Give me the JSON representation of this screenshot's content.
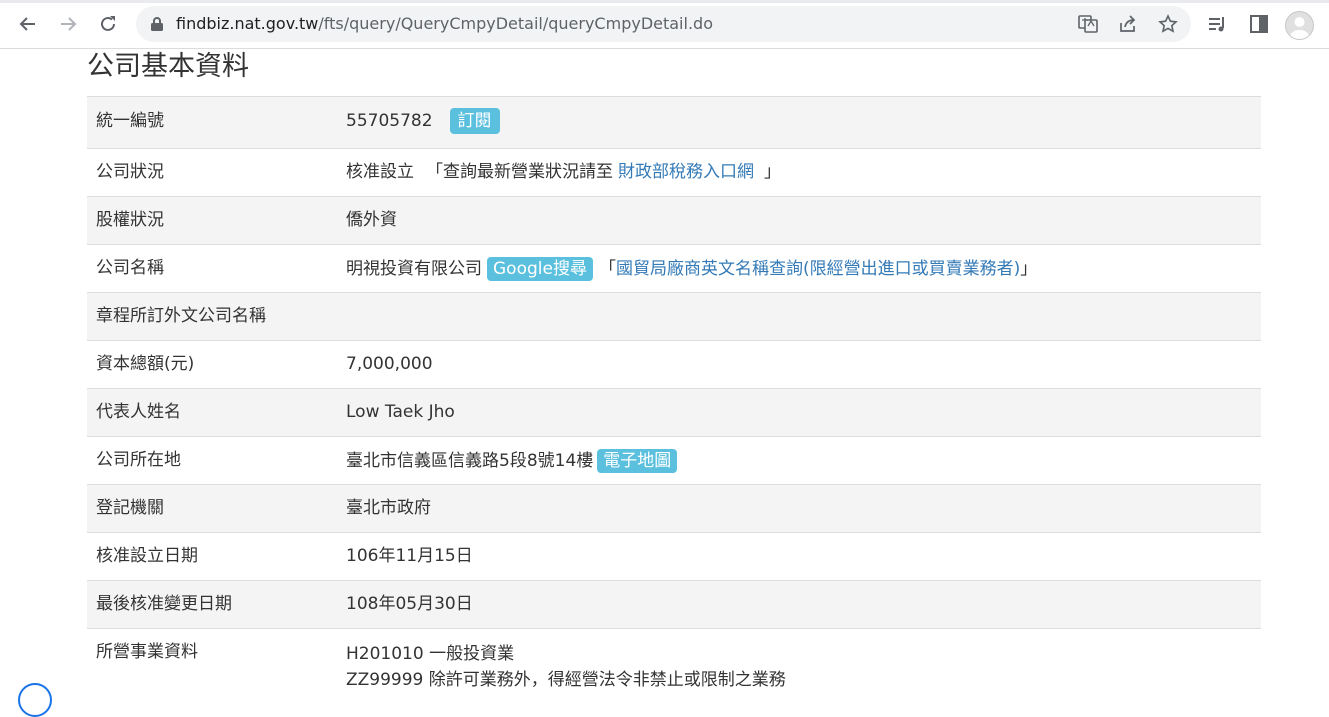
{
  "browser": {
    "url_host": "findbiz.nat.gov.tw",
    "url_path": "/fts/query/QueryCmpyDetail/queryCmpyDetail.do"
  },
  "page": {
    "title": "公司基本資料"
  },
  "rows": [
    {
      "label": "統一編號",
      "value": "55705782",
      "tag": "訂閱"
    },
    {
      "label": "公司狀況",
      "value": "核准設立",
      "prefix": "「查詢最新營業狀況請至",
      "link": "財政部稅務入口網",
      "suffix": "」"
    },
    {
      "label": "股權狀況",
      "value": "僑外資"
    },
    {
      "label": "公司名稱",
      "value": "明視投資有限公司",
      "tag": "Google搜尋",
      "prefix": "「",
      "link": "國貿局廠商英文名稱查詢(限經營出進口或買賣業務者)",
      "suffix": "」"
    },
    {
      "label": "章程所訂外文公司名稱",
      "value": ""
    },
    {
      "label": "資本總額(元)",
      "value": "7,000,000"
    },
    {
      "label": "代表人姓名",
      "value": "Low Taek Jho"
    },
    {
      "label": "公司所在地",
      "value": "臺北市信義區信義路5段8號14樓",
      "tag": "電子地圖"
    },
    {
      "label": "登記機關",
      "value": "臺北市政府"
    },
    {
      "label": "核准設立日期",
      "value": "106年11月15日"
    },
    {
      "label": "最後核准變更日期",
      "value": "108年05月30日"
    },
    {
      "label": "所營事業資料",
      "lines": [
        "H201010  一般投資業",
        "ZZ99999  除許可業務外，得經營法令非禁止或限制之業務"
      ]
    }
  ]
}
